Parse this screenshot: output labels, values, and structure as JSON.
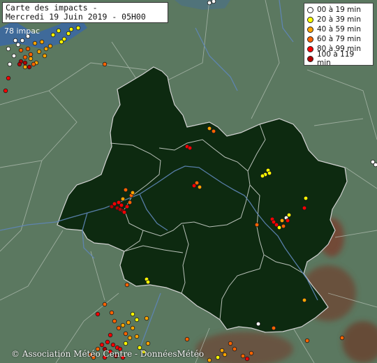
{
  "map": {
    "title_line1": "Carte des impacts -",
    "title_line2": "Mercredi 19 Juin 2019 - 05H00",
    "count_label": "78 impac",
    "credit": "© Association Météo Centre - DonnéesMétéo",
    "region": "Centre-Val de Loire",
    "colors": {
      "land": "#5b7860",
      "region_fill": "#0d2a10",
      "borders": "#c8c8c8",
      "rivers": "#5f86b8"
    }
  },
  "legend": [
    {
      "label": "00 à 19 min",
      "color": "#ffffff"
    },
    {
      "label": "20 à 39 min",
      "color": "#ffff00"
    },
    {
      "label": "40 à 59 min",
      "color": "#ffa500"
    },
    {
      "label": "60 à 79 min",
      "color": "#ff6400"
    },
    {
      "label": "80 à 99 min",
      "color": "#ff0000"
    },
    {
      "label": "100 à 119 min",
      "color": "#b40000"
    }
  ]
}
